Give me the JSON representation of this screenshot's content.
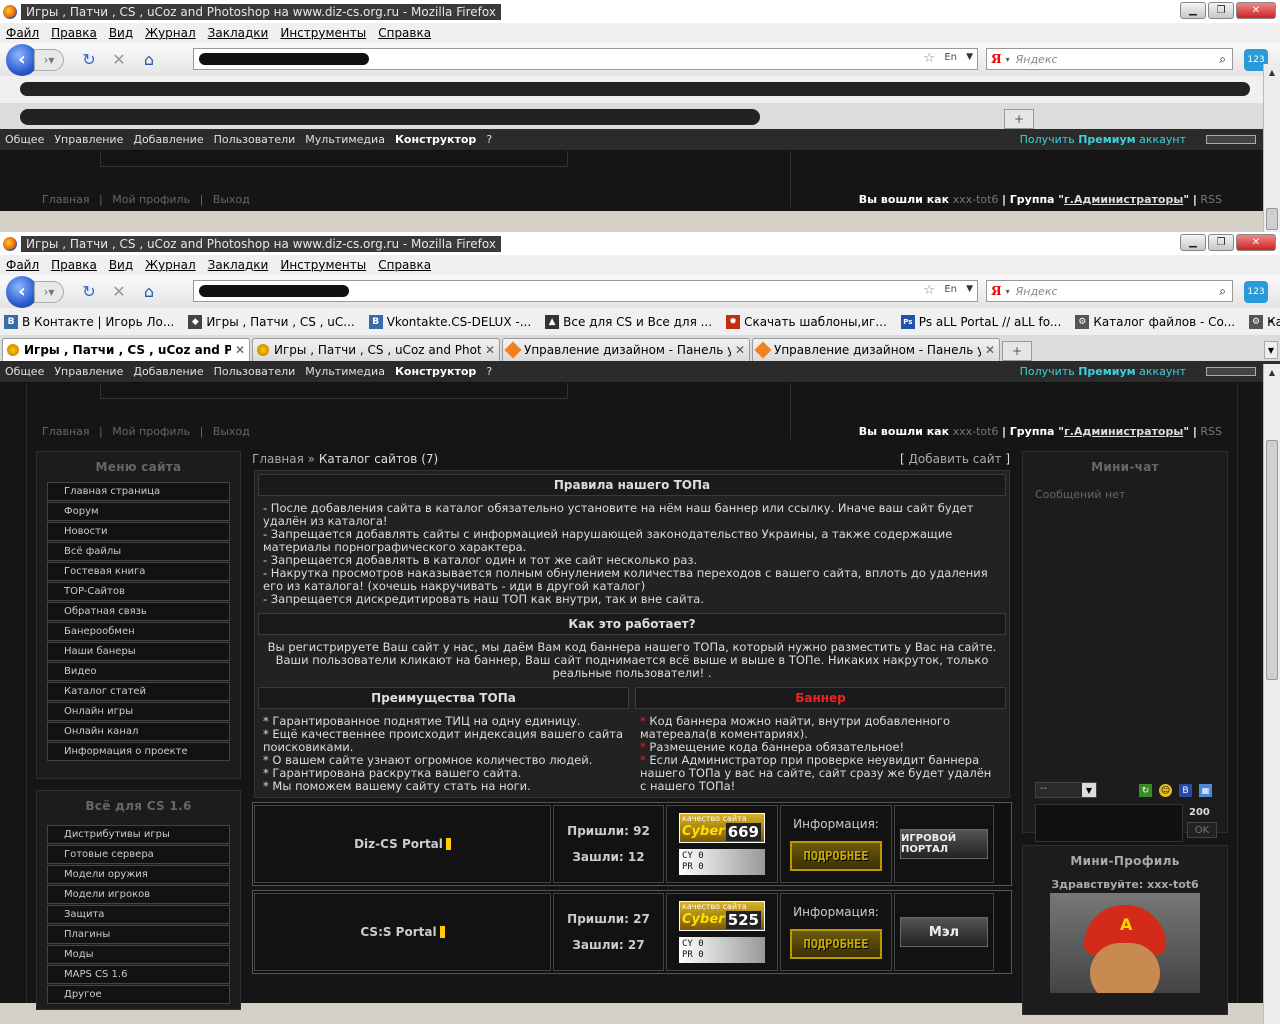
{
  "window": {
    "title": "Игры , Патчи , CS , uCoz and Photoshop на www.diz-cs.org.ru - Mozilla Firefox",
    "min_label": "▁",
    "max_label": "❐",
    "close_label": "✕"
  },
  "menu": [
    "Файл",
    "Правка",
    "Вид",
    "Журнал",
    "Закладки",
    "Инструменты",
    "Справка"
  ],
  "search": {
    "engine": "Я",
    "placeholder": "Яндекс"
  },
  "url": {
    "lang": "En"
  },
  "addon_label": "123",
  "bookmarks": [
    {
      "label": "В Контакте | Игорь Ло...",
      "icon": "vk-icon",
      "color": "#3a6aa8",
      "glyph": "B"
    },
    {
      "label": "Игры , Патчи , CS , uC...",
      "icon": "site-icon",
      "color": "#444",
      "glyph": "◆"
    },
    {
      "label": "Vkontakte.CS-DELUX -...",
      "icon": "vk-icon",
      "color": "#3a6aa8",
      "glyph": "B"
    },
    {
      "label": "Все для CS и Все для ...",
      "icon": "cs-icon",
      "color": "#333",
      "glyph": "▲"
    },
    {
      "label": "Скачать шаблоны,иг...",
      "icon": "fire-icon",
      "color": "#c03010",
      "glyph": "✹"
    },
    {
      "label": "Ps aLL PortaL // aLL fo...",
      "icon": "ps-icon",
      "color": "#2255aa",
      "glyph": "Ps"
    },
    {
      "label": "Каталог файлов - Co...",
      "icon": "gear-icon",
      "color": "#555",
      "glyph": "⚙"
    },
    {
      "label": "Каталог файлов - Ga...",
      "icon": "gear-icon",
      "color": "#555",
      "glyph": "⚙"
    }
  ],
  "tabs": [
    {
      "label": "Игры , Патчи , CS , uCoz and Phot...",
      "active": true
    },
    {
      "label": "Игры , Патчи , CS , uCoz and Phot...",
      "active": false
    },
    {
      "label": "Управление дизайном - Панель у...",
      "active": false
    },
    {
      "label": "Управление дизайном - Панель у...",
      "active": false
    }
  ],
  "newtab_label": "+",
  "ucoz": {
    "items": [
      "Общее",
      "Управление",
      "Добавление",
      "Пользователи",
      "Мультимедиа"
    ],
    "bold_item": "Конструктор",
    "help": "?",
    "premium": {
      "pre": "Получить ",
      "bold": "Премиум",
      "post": " аккаунт"
    }
  },
  "sitebar": {
    "links": [
      "Главная",
      "|",
      "Мой профиль",
      "|",
      "Выход"
    ],
    "logged": "Вы вошли как",
    "user": "xxx-tot6",
    "group_pre": "| Группа \"",
    "group": "г.Администраторы",
    "group_post": "\" |",
    "rss": "RSS"
  },
  "left": {
    "menu_title": "Меню сайта",
    "menu": [
      "Главная страница",
      "Форум",
      "Новости",
      "Всё файлы",
      "Гостевая книга",
      "TOP-Сайтов",
      "Обратная связь",
      "Банерообмен",
      "Наши банеры",
      "Видео",
      "Каталог статей",
      "Онлайн игры",
      "Онлайн канал",
      "Информация о проекте"
    ],
    "cs_title": "Всё для CS 1.6",
    "cs": [
      "Дистрибутивы игры",
      "Готовые сервера",
      "Модели оружия",
      "Модели игроков",
      "Защита",
      "Плагины",
      "Моды",
      "MAPS CS 1.6",
      "Другое"
    ]
  },
  "crumb": {
    "home": "Главная",
    "sep": "»",
    "current": "Каталог сайтов",
    "count": "(7)",
    "add": "Добавить сайт"
  },
  "rules": {
    "title": "Правила нашего ТОПа",
    "lines": [
      "- После добавления сайта в каталог обязательно установите на нём наш баннер или ссылку. Иначе ваш сайт будет удалён из каталога!",
      "- Запрещается добавлять сайты с информацией нарушающей законодательство Украины, а также содержащие материалы порнографического характера.",
      "- Запрещается добавлять в каталог один и тот же сайт несколько раз.",
      "- Накрутка просмотров наказывается полным обнулением количества переходов с вашего сайта, вплоть до удаления его из каталога! (хочешь накручивать - иди в другой каталог)",
      "- Запрещается дискредитировать наш ТОП как внутри, так и вне сайта."
    ]
  },
  "how": {
    "title": "Как это работает?",
    "text": "Вы регистрируете Ваш сайт у нас, мы даём Вам код баннера нашего ТОПа, который нужно разместить у Вас на сайте. Ваши пользователи кликают на баннер, Ваш сайт поднимается всё выше и выше в ТОПе. Никаких накруток, только реальные пользователи! ."
  },
  "adv": {
    "title": "Преимущества ТОПа",
    "lines": [
      "* Гарантированное поднятие ТИЦ на одну единицу.",
      "* Ещё качественнее происходит индексация вашего сайта поисковиками.",
      "* О вашем сайте узнают огромное количество людей.",
      "* Гарантирована раскрутка вашего сайта.",
      "* Мы поможем вашему сайту стать на ноги."
    ]
  },
  "banner": {
    "title": "Баннер",
    "lines": [
      "Код баннера можно найти, внутри добавленного матереала(в коментариях).",
      "Размещение кода баннера обязательное!",
      "Если Администратор при проверке неувидит баннера нашего ТОПа у вас на сайте, сайт сразу же будет удалён с нашего ТОПа!"
    ],
    "star": "*"
  },
  "sites": [
    {
      "name": "Diz-CS Portal",
      "in_label": "Пришли:",
      "in": "92",
      "out_label": "Зашли:",
      "out": "12",
      "quality": "качество сайта",
      "brand": "Cyber",
      "rank": "669",
      "cy": "CY 0",
      "pr": "PR 0",
      "info": "Информация:",
      "more": "ПОДРОБНЕЕ",
      "ban": "ИГРОВОЙ ПОРТАЛ"
    },
    {
      "name": "CS:S Portal",
      "in_label": "Пришли:",
      "in": "27",
      "out_label": "Зашли:",
      "out": "27",
      "quality": "качество сайта",
      "brand": "Cyber",
      "rank": "525",
      "cy": "CY 0",
      "pr": "PR 0",
      "info": "Информация:",
      "more": "ПОДРОБНЕЕ",
      "ban": "Мэл"
    }
  ],
  "right": {
    "chat_title": "Мини-чат",
    "chat_empty": "Сообщений нет",
    "chat_select": "--",
    "chat_count": "200",
    "chat_ok": "OK",
    "profile_title": "Мини-Профиль",
    "greet": "Здравствуйте:",
    "user": "xxx-tot6"
  }
}
